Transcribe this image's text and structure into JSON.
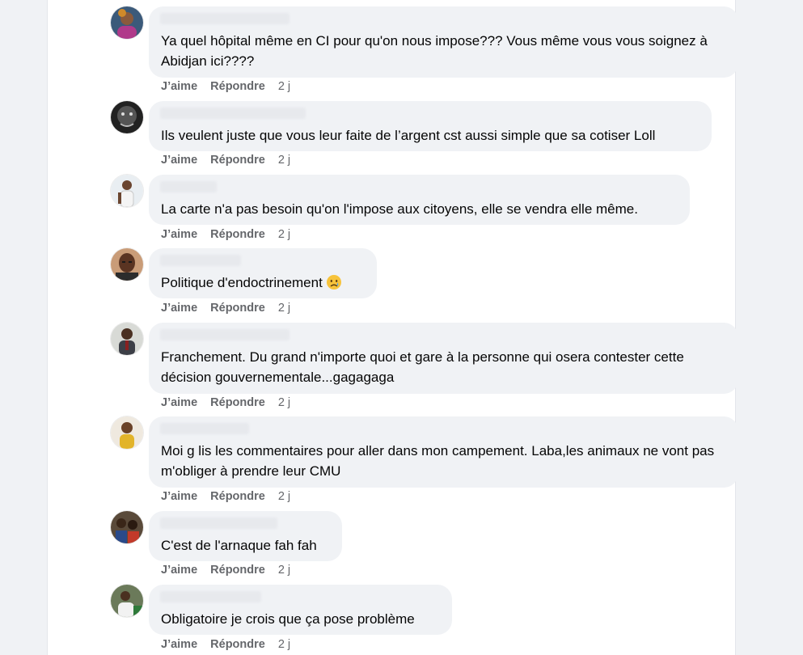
{
  "colors": {
    "bubble": "#f0f2f5",
    "meta": "#65676b",
    "text": "#050505"
  },
  "comments": [
    {
      "text": "Ya quel hôpital même en CI pour qu'on nous impose??? Vous même vous vous soignez à Abidjan ici????",
      "like": "J’aime",
      "reply": "Répondre",
      "time": "2 j"
    },
    {
      "text": "Ils veulent juste que vous leur faite de l’argent cst aussi simple que sa cotiser Loll",
      "like": "J’aime",
      "reply": "Répondre",
      "time": "2 j"
    },
    {
      "text": "La carte n'a pas besoin qu'on l'impose aux citoyens, elle se vendra elle même.",
      "like": "J’aime",
      "reply": "Répondre",
      "time": "2 j"
    },
    {
      "text": "Politique d'endoctrinement",
      "emoji": "sad-emoji-icon",
      "like": "J’aime",
      "reply": "Répondre",
      "time": "2 j"
    },
    {
      "text": "Franchement. Du grand n'importe quoi et gare à la personne qui osera contester cette décision gouvernementale...gagagaga",
      "like": "J’aime",
      "reply": "Répondre",
      "time": "2 j"
    },
    {
      "text": "Moi g lis les commentaires pour aller dans mon campement. Laba,les animaux ne vont pas m'obliger à prendre leur CMU",
      "like": "J’aime",
      "reply": "Répondre",
      "time": "2 j"
    },
    {
      "text": "C'est de l'arnaque fah fah",
      "like": "J’aime",
      "reply": "Répondre",
      "time": "2 j"
    },
    {
      "text": "Obligatoire je crois que ça pose problème",
      "like": "J’aime",
      "reply": "Répondre",
      "time": "2 j"
    }
  ]
}
